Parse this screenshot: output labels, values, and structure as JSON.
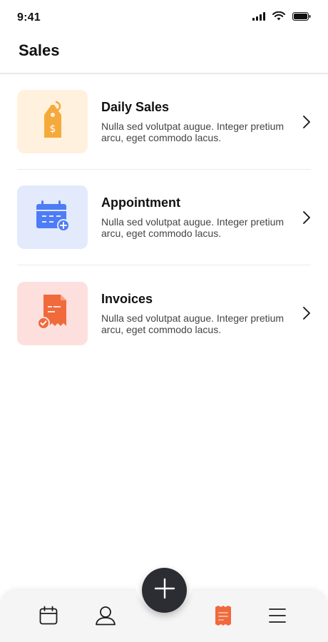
{
  "status_bar": {
    "time": "9:41"
  },
  "header": {
    "title": "Sales"
  },
  "items": [
    {
      "title": "Daily Sales",
      "description": "Nulla sed volutpat augue. Integer pretium arcu, eget commodo lacus.",
      "icon": "price-tag-icon",
      "bg": "#fff1de",
      "accent": "#f6a93b"
    },
    {
      "title": "Appointment",
      "description": "Nulla sed volutpat augue. Integer pretium arcu, eget commodo lacus.",
      "icon": "calendar-plus-icon",
      "bg": "#e2eafc",
      "accent": "#4d7cf6"
    },
    {
      "title": "Invoices",
      "description": "Nulla sed volutpat augue. Integer pretium arcu, eget commodo lacus.",
      "icon": "receipt-icon",
      "bg": "#fde0de",
      "accent": "#f06a3c"
    }
  ],
  "bottom_nav": {
    "items": [
      {
        "icon": "calendar-icon",
        "active": false
      },
      {
        "icon": "user-icon",
        "active": false
      },
      {
        "icon": "add-icon",
        "active": false
      },
      {
        "icon": "receipt-nav-icon",
        "active": true
      },
      {
        "icon": "menu-icon",
        "active": false
      }
    ],
    "active_color": "#f06a3c"
  }
}
